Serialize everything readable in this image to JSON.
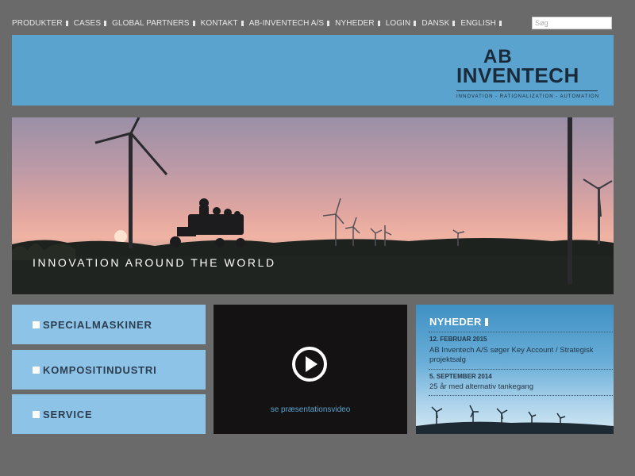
{
  "nav": {
    "items": [
      {
        "label": "PRODUKTER"
      },
      {
        "label": "CASES"
      },
      {
        "label": "GLOBAL PARTNERS"
      },
      {
        "label": "KONTAKT"
      },
      {
        "label": "AB-INVENTECH A/S"
      },
      {
        "label": "NYHEDER"
      },
      {
        "label": "LOGIN"
      },
      {
        "label": "DANSK"
      },
      {
        "label": "ENGLISH"
      }
    ]
  },
  "search": {
    "placeholder": "Søg",
    "value": ""
  },
  "logo": {
    "ab": "AB",
    "name": "INVENTECH",
    "tagline": "INNOVATION - RATIONALIZATION - AUTOMATION"
  },
  "hero": {
    "caption": "INNOVATION AROUND THE WORLD"
  },
  "menu": {
    "items": [
      {
        "label": "SPECIALMASKINER"
      },
      {
        "label": "KOMPOSITINDUSTRI"
      },
      {
        "label": "SERVICE"
      }
    ]
  },
  "video": {
    "link_label": "se præsentationsvideo"
  },
  "news": {
    "title": "NYHEDER",
    "items": [
      {
        "date": "12. FEBRUAR 2015",
        "text": "AB Inventech A/S søger Key Account / Strategisk projektsalg"
      },
      {
        "date": "5. SEPTEMBER 2014",
        "text": "25 år med alternativ tankegang"
      }
    ]
  },
  "colors": {
    "background": "#6a6a6a",
    "header_blue": "#5ba3cf",
    "menu_blue": "#8dc3e6",
    "logo_dark": "#1a2a3a",
    "video_bg": "#141212"
  }
}
